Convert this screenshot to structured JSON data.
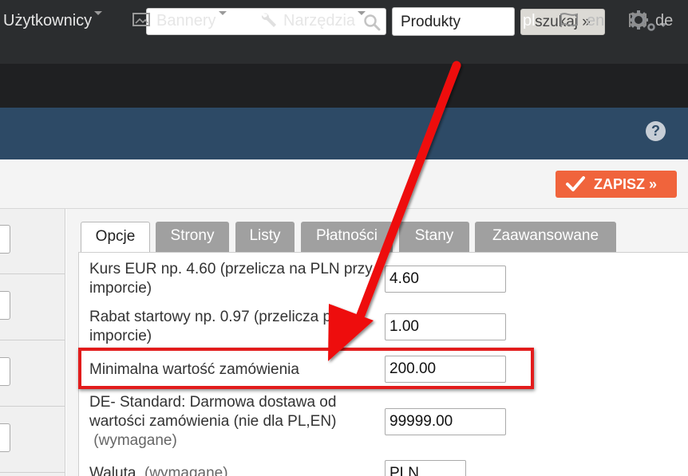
{
  "topbar": {
    "search_placeholder": "",
    "select_value": "Produkty",
    "search_button": "szukaj »"
  },
  "nav": {
    "items": [
      {
        "label": "Użytkownicy"
      },
      {
        "label": "Bannery"
      },
      {
        "label": "Narzędzia"
      }
    ],
    "languages": [
      {
        "code": "pl",
        "active": true
      },
      {
        "code": "en",
        "active": false
      },
      {
        "code": "de",
        "active": false
      }
    ]
  },
  "toolbar": {
    "save_label": "ZAPISZ »"
  },
  "tabs": [
    "Opcje",
    "Strony",
    "Listy",
    "Płatności",
    "Stany",
    "Zaawansowane"
  ],
  "form": {
    "rows": [
      {
        "label": "Kurs EUR np. 4.60 (przelicza na PLN przy imporcie)",
        "value": "4.60"
      },
      {
        "label": "Rabat startowy np. 0.97 (przelicza przy imporcie)",
        "value": "1.00"
      },
      {
        "label": "Minimalna wartość zamówienia",
        "value": "200.00"
      },
      {
        "label": "DE- Standard: Darmowa dostawa od wartości zamówienia (nie dla PL,EN)",
        "required": "(wymagane)",
        "value": "99999.00"
      },
      {
        "label": "Waluta",
        "required": "(wymagane)",
        "value": "PLN"
      }
    ]
  },
  "colors": {
    "topbar": "#2b2d2f",
    "navbar": "#1f2022",
    "header": "#2d4a66",
    "save_button": "#f0643c",
    "highlight": "#e21c1c"
  }
}
